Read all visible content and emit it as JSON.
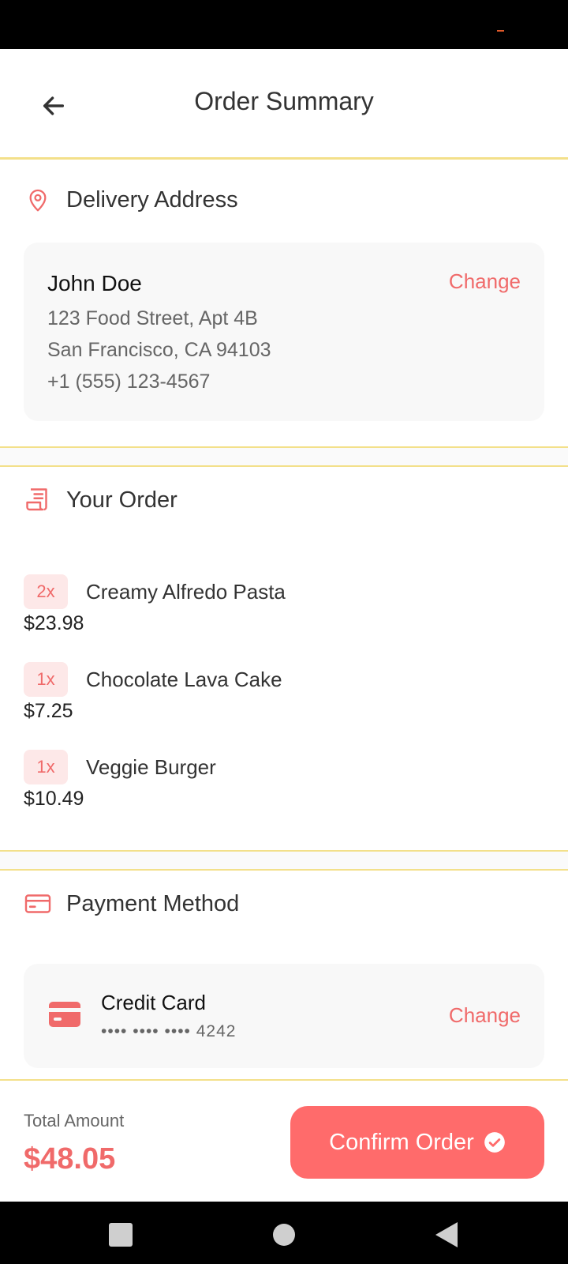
{
  "header": {
    "title": "Order Summary",
    "back_icon": "arrow-left-icon"
  },
  "delivery": {
    "title": "Delivery Address",
    "icon": "location-pin-icon",
    "name": "John Doe",
    "lines": [
      "123 Food Street, Apt 4B",
      "San Francisco, CA 94103",
      "+1 (555) 123-4567"
    ],
    "change_label": "Change"
  },
  "order": {
    "title": "Your Order",
    "icon": "receipt-icon",
    "items": [
      {
        "qty": "2x",
        "name": "Creamy Alfredo Pasta",
        "price": "$23.98"
      },
      {
        "qty": "1x",
        "name": "Chocolate Lava Cake",
        "price": "$7.25"
      },
      {
        "qty": "1x",
        "name": "Veggie Burger",
        "price": "$10.49"
      }
    ]
  },
  "payment": {
    "title": "Payment Method",
    "icon": "credit-card-icon",
    "method": "Credit Card",
    "number": "•••• •••• •••• 4242",
    "change_label": "Change"
  },
  "footer": {
    "total_label": "Total Amount",
    "total_value": "$48.05",
    "confirm_label": "Confirm Order"
  },
  "colors": {
    "accent": "#ff6b6b",
    "accent_text": "#f06a6a",
    "divider": "#f3e08a",
    "badge_bg": "#fde8e8"
  }
}
